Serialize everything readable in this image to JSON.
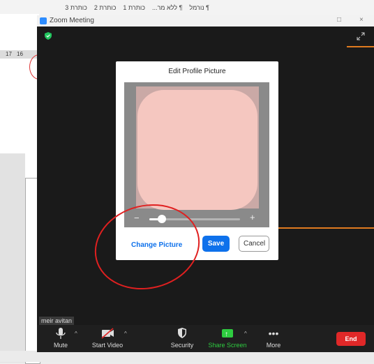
{
  "document": {
    "ribbon_styles": [
      "¶ נורמל",
      "¶ ללא מר...",
      "כותרת 1",
      "כותרת 2",
      "כותרת 3"
    ],
    "ruler": [
      "17",
      "16"
    ]
  },
  "window": {
    "title": "Zoom Meeting",
    "restore_glyph": "□",
    "close_glyph": "×"
  },
  "dialog": {
    "title": "Edit Profile Picture",
    "slider": {
      "minus": "−",
      "plus": "+",
      "zoom_fraction": 0.1
    },
    "change_picture": "Change Picture",
    "save": "Save",
    "cancel": "Cancel"
  },
  "participant": {
    "name": "meir avitan"
  },
  "toolbar": {
    "mute": "Mute",
    "start_video": "Start Video",
    "security": "Security",
    "share_screen": "Share Screen",
    "more": "More",
    "end": "End"
  },
  "colors": {
    "accent_blue": "#0e71eb",
    "end_red": "#e02828",
    "share_green": "#2ecc40",
    "annotation_red": "#e02020",
    "annotation_orange": "#e07b1f"
  },
  "icons": {
    "shield": "shield-icon",
    "expand": "expand-icon",
    "mic": "microphone-icon",
    "video": "video-off-icon",
    "security": "shield-icon",
    "share": "share-screen-icon",
    "more": "more-icon"
  }
}
